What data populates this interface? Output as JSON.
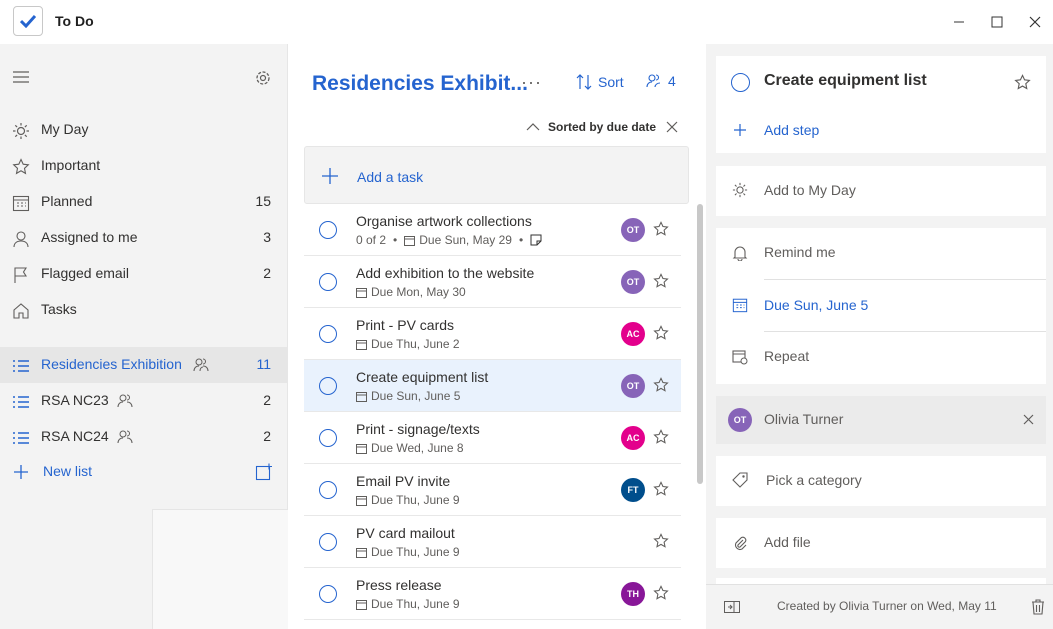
{
  "app": {
    "title": "To Do"
  },
  "sidebar": {
    "items": [
      {
        "label": "My Day",
        "count": ""
      },
      {
        "label": "Important",
        "count": ""
      },
      {
        "label": "Planned",
        "count": "15"
      },
      {
        "label": "Assigned to me",
        "count": "3"
      },
      {
        "label": "Flagged email",
        "count": "2"
      },
      {
        "label": "Tasks",
        "count": ""
      }
    ],
    "lists": [
      {
        "label": "Residencies Exhibition",
        "count": "11"
      },
      {
        "label": "RSA NC23",
        "count": "2"
      },
      {
        "label": "RSA NC24",
        "count": "2"
      }
    ],
    "new_list": "New list"
  },
  "main": {
    "list_title": "Residencies Exhibit...",
    "more": "···",
    "sort_label": "Sort",
    "share_count": "4",
    "sorted_by": "Sorted by due date",
    "add_task": "Add a task",
    "tasks": [
      {
        "title": "Organise artwork collections",
        "progress": "0 of 2",
        "due": "Due Sun, May 29",
        "avatar": "OT",
        "avatar_color": "#8764b8"
      },
      {
        "title": "Add exhibition to the website",
        "progress": "",
        "due": "Due Mon, May 30",
        "avatar": "OT",
        "avatar_color": "#8764b8"
      },
      {
        "title": "Print - PV cards",
        "progress": "",
        "due": "Due Thu, June 2",
        "avatar": "AC",
        "avatar_color": "#e3008c"
      },
      {
        "title": "Create equipment list",
        "progress": "",
        "due": "Due Sun, June 5",
        "avatar": "OT",
        "avatar_color": "#8764b8"
      },
      {
        "title": "Print - signage/texts",
        "progress": "",
        "due": "Due Wed, June 8",
        "avatar": "AC",
        "avatar_color": "#e3008c"
      },
      {
        "title": "Email PV invite",
        "progress": "",
        "due": "Due Thu, June 9",
        "avatar": "FT",
        "avatar_color": "#004e8c"
      },
      {
        "title": "PV card mailout",
        "progress": "",
        "due": "Due Thu, June 9",
        "avatar": "",
        "avatar_color": ""
      },
      {
        "title": "Press release",
        "progress": "",
        "due": "Due Thu, June 9",
        "avatar": "TH",
        "avatar_color": "#881798"
      }
    ]
  },
  "detail": {
    "task_title": "Create equipment list",
    "add_step": "Add step",
    "add_to_my_day": "Add to My Day",
    "remind_me": "Remind me",
    "due": "Due Sun, June 5",
    "repeat": "Repeat",
    "assignee_initials": "OT",
    "assignee_name": "Olivia Turner",
    "pick_category": "Pick a category",
    "add_file": "Add file",
    "created": "Created by Olivia Turner on Wed, May 11"
  },
  "colors": {
    "accent": "#2564cf",
    "sidebar_bg": "#f3f3f3"
  }
}
